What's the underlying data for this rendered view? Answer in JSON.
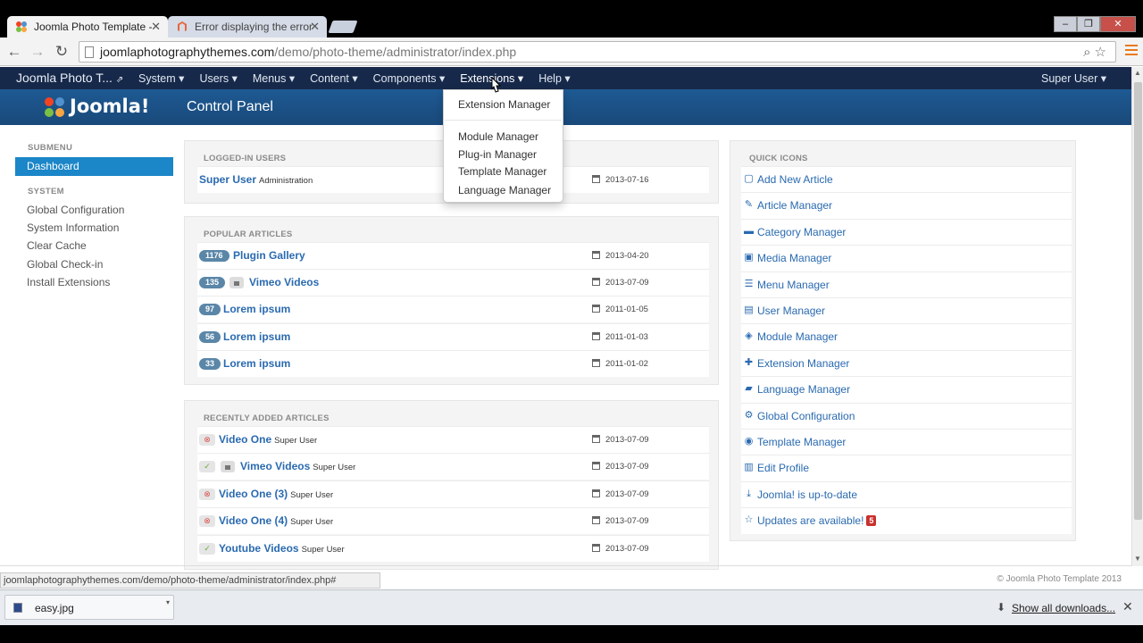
{
  "browser": {
    "tabs": [
      {
        "title": "Joomla Photo Template -",
        "active": true
      },
      {
        "title": "Error displaying the error",
        "active": false
      }
    ],
    "window_buttons": [
      "–",
      "❐",
      "✕"
    ],
    "url_host": "joomlaphotographythemes.com",
    "url_path": "/demo/photo-theme/administrator/index.php"
  },
  "navbar": {
    "brand": "Joomla Photo T...",
    "menus": [
      "System",
      "Users",
      "Menus",
      "Content",
      "Components",
      "Extensions",
      "Help"
    ],
    "user": "Super User"
  },
  "header": {
    "logo_text": "Joomla!",
    "page_title": "Control Panel"
  },
  "dropdown": {
    "items": [
      "Extension Manager",
      "Module Manager",
      "Plug-in Manager",
      "Template Manager",
      "Language Manager"
    ]
  },
  "sidebar": {
    "submenu_header": "SUBMENU",
    "active_item": "Dashboard",
    "system_header": "SYSTEM",
    "items": [
      "Global Configuration",
      "System Information",
      "Clear Cache",
      "Global Check-in",
      "Install Extensions"
    ]
  },
  "logged_in": {
    "header": "LOGGED-IN USERS",
    "rows": [
      {
        "name": "Super User",
        "role": "Administration",
        "date": "2013-07-16"
      }
    ]
  },
  "popular": {
    "header": "POPULAR ARTICLES",
    "rows": [
      {
        "hits": "1176",
        "title": "Plugin Gallery",
        "date": "2013-04-20",
        "locked": false
      },
      {
        "hits": "135",
        "title": "Vimeo Videos",
        "date": "2013-07-09",
        "locked": true
      },
      {
        "hits": "97",
        "title": "Lorem ipsum",
        "date": "2011-01-05",
        "locked": false
      },
      {
        "hits": "56",
        "title": "Lorem ipsum",
        "date": "2011-01-03",
        "locked": false
      },
      {
        "hits": "33",
        "title": "Lorem ipsum",
        "date": "2011-01-02",
        "locked": false
      }
    ]
  },
  "recent": {
    "header": "RECENTLY ADDED ARTICLES",
    "rows": [
      {
        "title": "Video One",
        "author": "Super User",
        "date": "2013-07-09",
        "published": false,
        "locked": false
      },
      {
        "title": "Vimeo Videos",
        "author": "Super User",
        "date": "2013-07-09",
        "published": true,
        "locked": true
      },
      {
        "title": "Video One (3)",
        "author": "Super User",
        "date": "2013-07-09",
        "published": false,
        "locked": false
      },
      {
        "title": "Video One (4)",
        "author": "Super User",
        "date": "2013-07-09",
        "published": false,
        "locked": false
      },
      {
        "title": "Youtube Videos",
        "author": "Super User",
        "date": "2013-07-09",
        "published": true,
        "locked": false
      }
    ]
  },
  "quick_icons": {
    "header": "QUICK ICONS",
    "items": [
      {
        "label": "Add New Article",
        "icon": "file-add-icon",
        "glyph": "▢"
      },
      {
        "label": "Article Manager",
        "icon": "pencil-icon",
        "glyph": "✎"
      },
      {
        "label": "Category Manager",
        "icon": "folder-icon",
        "glyph": "▬"
      },
      {
        "label": "Media Manager",
        "icon": "picture-icon",
        "glyph": "▣"
      },
      {
        "label": "Menu Manager",
        "icon": "list-icon",
        "glyph": "☰"
      },
      {
        "label": "User Manager",
        "icon": "user-icon",
        "glyph": "▤"
      },
      {
        "label": "Module Manager",
        "icon": "cube-icon",
        "glyph": "◈"
      },
      {
        "label": "Extension Manager",
        "icon": "puzzle-icon",
        "glyph": "✚"
      },
      {
        "label": "Language Manager",
        "icon": "comments-icon",
        "glyph": "▰"
      },
      {
        "label": "Global Configuration",
        "icon": "cog-icon",
        "glyph": "⚙"
      },
      {
        "label": "Template Manager",
        "icon": "eye-icon",
        "glyph": "◉"
      },
      {
        "label": "Edit Profile",
        "icon": "vcard-icon",
        "glyph": "▥"
      },
      {
        "label": "Joomla! is up-to-date",
        "icon": "download-icon",
        "glyph": "⤓"
      },
      {
        "label": "Updates are available!",
        "icon": "star-icon",
        "glyph": "☆",
        "badge": "5"
      }
    ]
  },
  "status_url": "joomlaphotographythemes.com/demo/photo-theme/administrator/index.php#",
  "copyright": "© Joomla Photo Template 2013",
  "downloads": {
    "file": "easy.jpg",
    "show_all": "Show all downloads..."
  },
  "colors": {
    "navbar": "#17294a",
    "header": "#1e5a93",
    "active": "#1b86c8",
    "link": "#2a6ab0"
  }
}
